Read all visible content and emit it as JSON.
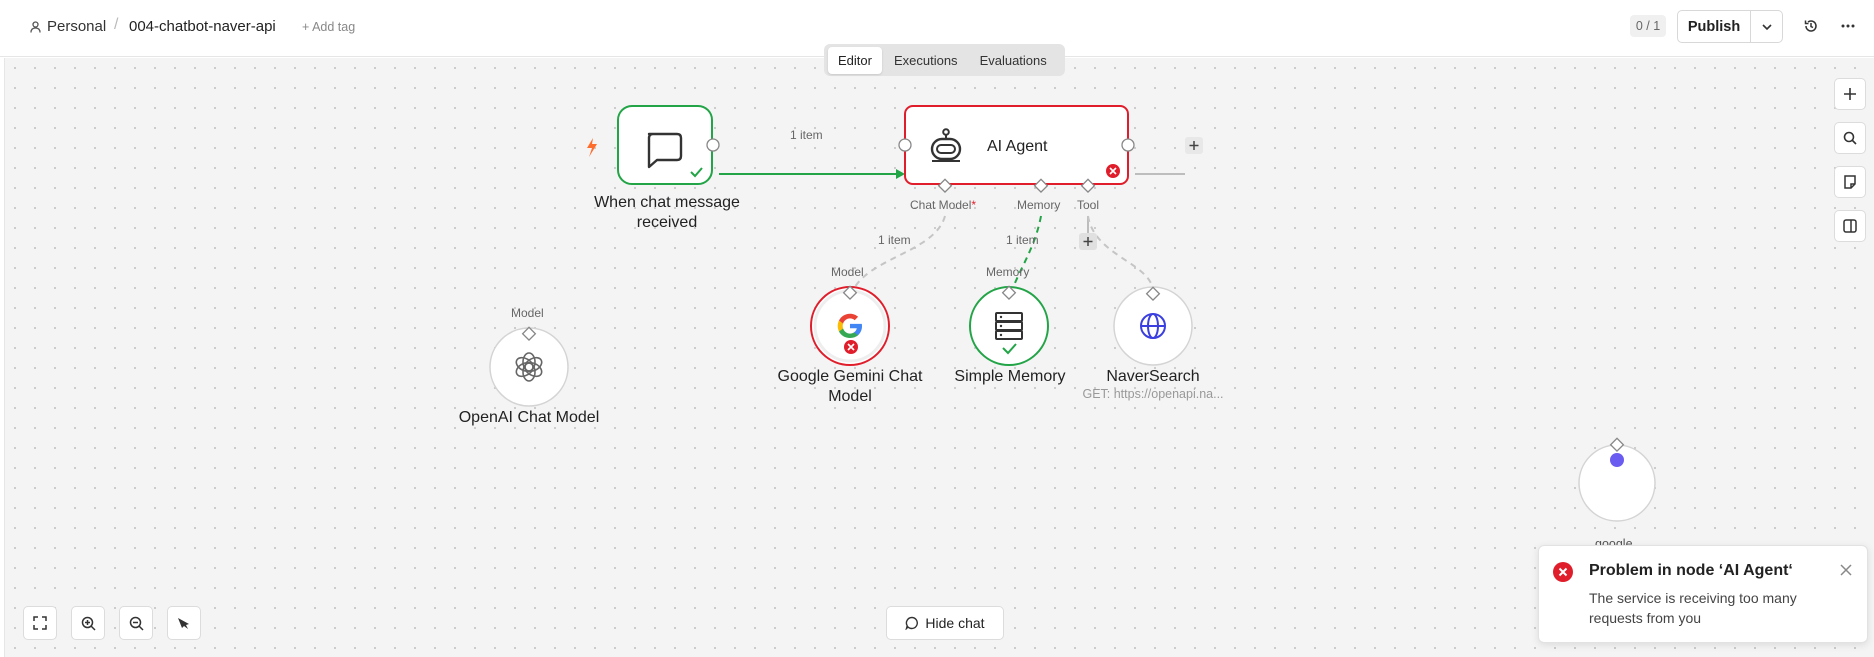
{
  "breadcrumb": {
    "owner": "Personal",
    "separator": "/",
    "workflow_name": "004-chatbot-naver-api",
    "add_tag": "+ Add tag"
  },
  "header": {
    "counter": "0 / 1",
    "publish_label": "Publish"
  },
  "tabs": [
    "Editor",
    "Executions",
    "Evaluations"
  ],
  "active_tab": "Editor",
  "nodes": {
    "trigger": {
      "label_line1": "When chat message",
      "label_line2": "received"
    },
    "agent": {
      "label": "AI Agent",
      "port_chat_model": "Chat Model",
      "required_mark": "*",
      "port_memory": "Memory",
      "port_tool": "Tool"
    },
    "gemini": {
      "label_line1": "Google Gemini Chat",
      "label_line2": "Model",
      "port": "Model"
    },
    "memory": {
      "label": "Simple Memory",
      "port": "Memory"
    },
    "naver": {
      "label": "NaverSearch",
      "subtitle": "GET: https://openapi.na..."
    },
    "openai": {
      "label": "OpenAI Chat Model",
      "port": "Model"
    },
    "partial": {
      "label": "google"
    }
  },
  "connections": {
    "trigger_agent": "1 item",
    "model_link": "1 item",
    "memory_link": "1 item"
  },
  "bottom": {
    "hide_chat": "Hide chat"
  },
  "toast": {
    "title": "Problem in node ‘AI Agent‘",
    "message": "The service is receiving too many requests from you"
  },
  "colors": {
    "success": "#22a447",
    "error": "#e01e2b",
    "accent": "#ff6d2d",
    "globe": "#3b3fe0"
  }
}
